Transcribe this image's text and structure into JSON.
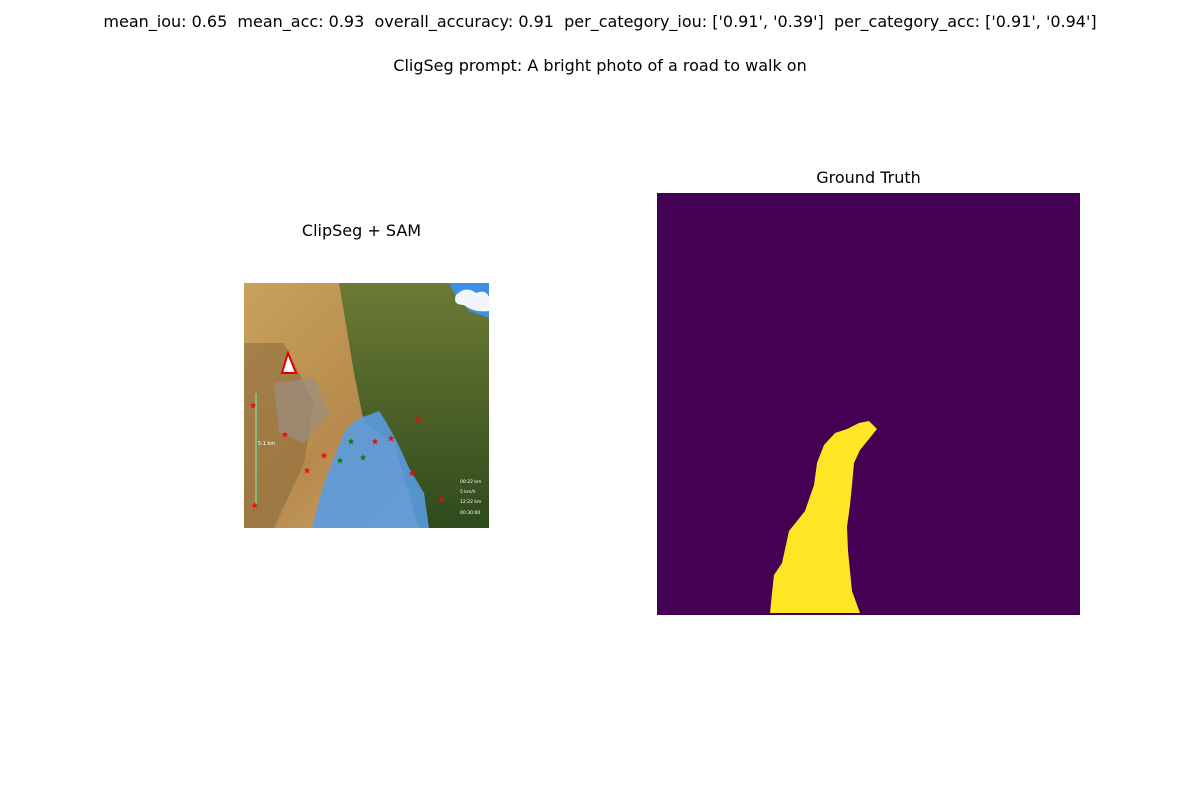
{
  "header": {
    "metrics_line": "mean_iou: 0.65  mean_acc: 0.93  overall_accuracy: 0.91  per_category_iou: ['0.91', '0.39']  per_category_acc: ['0.91', '0.94']",
    "prompt_line": "CligSeg prompt: A bright photo of a road to walk on"
  },
  "panels": {
    "left_title": "ClipSeg + SAM",
    "right_title": "Ground Truth"
  },
  "overlay_text": {
    "distance_marker": "5.1 km",
    "stats": [
      "00:22 km",
      "5 km/h",
      "12:22 km",
      "00:30:00"
    ]
  },
  "colors": {
    "background_class": "#440154",
    "road_class": "#fde725",
    "mask_overlay": "#4a90e2",
    "negative_point": "#ff0000",
    "positive_point": "#008000"
  }
}
